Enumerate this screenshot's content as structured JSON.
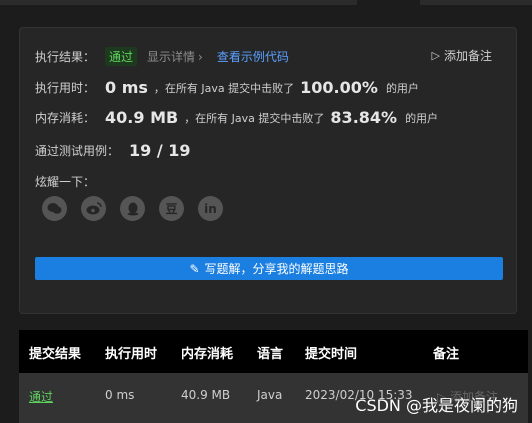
{
  "result": {
    "label": "执行结果：",
    "status": "通过",
    "details": "显示详情",
    "view_example": "查看示例代码",
    "add_note": "添加备注"
  },
  "runtime": {
    "label": "执行用时：",
    "value": "0 ms",
    "text": "，在所有 Java 提交中击败了",
    "percent": "100.00%",
    "suffix": "的用户"
  },
  "memory": {
    "label": "内存消耗：",
    "value": "40.9 MB",
    "text": "，在所有 Java 提交中击败了",
    "percent": "83.84%",
    "suffix": "的用户"
  },
  "tests": {
    "label": "通过测试用例：",
    "value": "19 / 19"
  },
  "share": {
    "label": "炫耀一下：",
    "icons": [
      "wechat-icon",
      "weibo-icon",
      "qq-icon",
      "douban-icon",
      "linkedin-icon"
    ],
    "douban_glyph": "豆",
    "linkedin_glyph": "in"
  },
  "write_solution": "写题解，分享我的解题思路",
  "table": {
    "headers": [
      "提交结果",
      "执行用时",
      "内存消耗",
      "语言",
      "提交时间",
      "备注"
    ],
    "rows": [
      {
        "result": "通过",
        "runtime": "0 ms",
        "memory": "40.9 MB",
        "language": "Java",
        "time": "2023/02/10 15:33",
        "note": "添加备注"
      }
    ]
  },
  "watermark": "CSDN @我是夜阑的狗",
  "colors": {
    "pass": "#5fd35f",
    "link": "#5aa0ff",
    "button": "#1a7fe0"
  }
}
